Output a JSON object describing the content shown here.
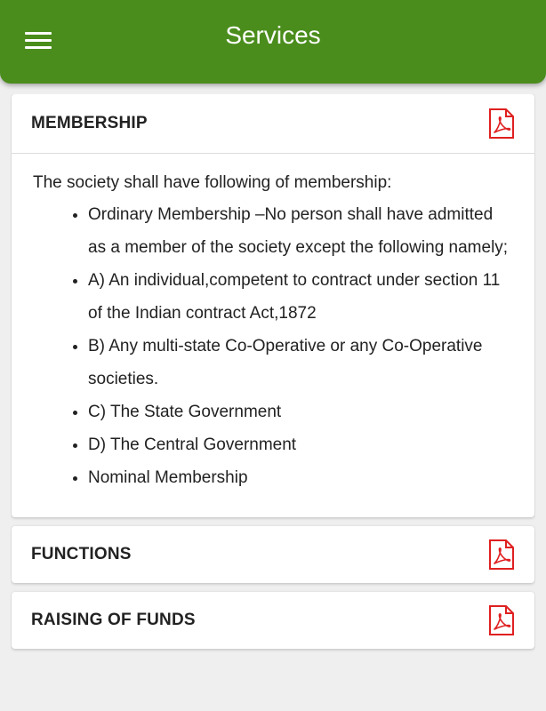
{
  "app_bar": {
    "title": "Services",
    "menu_icon": "hamburger-menu-icon",
    "color": "#4a8d1c"
  },
  "sections": [
    {
      "title": "MEMBERSHIP",
      "icon": "pdf-icon",
      "expanded": true,
      "intro": "The society shall have following of membership:",
      "items": [
        "Ordinary Membership –No person shall have admitted as a member of the society except the following namely;",
        "A) An individual,competent to contract under section 11 of the Indian contract Act,1872",
        "B) Any multi-state Co-Operative or any Co-Operative societies.",
        "C) The State Government",
        "D) The Central Government",
        "Nominal Membership"
      ]
    },
    {
      "title": "FUNCTIONS",
      "icon": "pdf-icon",
      "expanded": false
    },
    {
      "title": "RAISING OF FUNDS",
      "icon": "pdf-icon",
      "expanded": false
    }
  ],
  "colors": {
    "pdf_icon": "#e02020",
    "background": "#efefef"
  }
}
